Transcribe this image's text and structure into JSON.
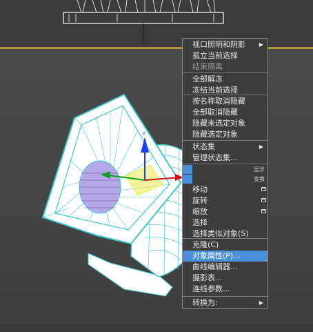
{
  "menu": {
    "items": [
      {
        "label": "视口照明和阴影",
        "disabled": false,
        "submenu": true
      },
      {
        "label": "孤立当前选择",
        "disabled": false
      },
      {
        "label": "结束隔离",
        "disabled": true
      },
      {
        "label": "全部解冻",
        "disabled": false
      },
      {
        "label": "冻结当前选择",
        "disabled": false
      },
      {
        "label": "按名称取消隐藏",
        "disabled": false
      },
      {
        "label": "全部取消隐藏",
        "disabled": false
      },
      {
        "label": "隐藏未选定对象",
        "disabled": false
      },
      {
        "label": "隐藏选定对象",
        "disabled": false
      },
      {
        "label": "状态集",
        "disabled": false,
        "submenu": true
      },
      {
        "label": "管理状态集...",
        "disabled": false
      },
      {
        "label": "移动",
        "disabled": false,
        "checkbox": true
      },
      {
        "label": "旋转",
        "disabled": false,
        "checkbox": true
      },
      {
        "label": "缩放",
        "disabled": false,
        "checkbox": true
      },
      {
        "label": "选择",
        "disabled": false
      },
      {
        "label": "选择类似对象(S)",
        "disabled": false
      },
      {
        "label": "克隆(C)",
        "disabled": false
      },
      {
        "label": "对象属性(P)...",
        "disabled": false,
        "highlighted": true
      },
      {
        "label": "曲线编辑器...",
        "disabled": false
      },
      {
        "label": "摄影表...",
        "disabled": false
      },
      {
        "label": "连线参数...",
        "disabled": false
      },
      {
        "label": "转换为:",
        "disabled": false,
        "submenu": true
      }
    ],
    "quad_labels": {
      "display": "显示",
      "transform": "变换"
    }
  },
  "colors": {
    "highlight": "#4a90d9",
    "wireframe": "#3cc8d0",
    "gizmo_z": "#1a3cff",
    "gizmo_x": "#d01010",
    "gizmo_y": "#10a020",
    "viewport_border": "#b8973a"
  },
  "icons": {
    "submenu": "triangle-right",
    "checkbox": "small-window-box"
  }
}
